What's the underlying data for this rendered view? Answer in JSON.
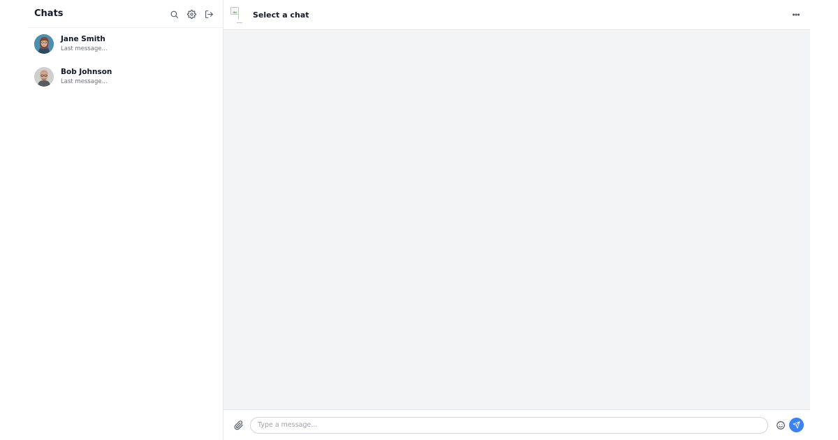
{
  "sidebar": {
    "title": "Chats",
    "actions": [
      {
        "name": "search-icon"
      },
      {
        "name": "gear-icon"
      },
      {
        "name": "logout-icon"
      }
    ],
    "chats": [
      {
        "name": "Jane Smith",
        "preview": "Last message...",
        "avatar": "woman-avatar"
      },
      {
        "name": "Bob Johnson",
        "preview": "Last message...",
        "avatar": "man-avatar"
      }
    ]
  },
  "main": {
    "header": {
      "title": "Select a chat",
      "menu_icon": "more-horizontal-icon"
    },
    "composer": {
      "placeholder": "Type a message...",
      "attach_icon": "paperclip-icon",
      "emoji_icon": "smile-icon",
      "send_icon": "send-icon"
    }
  },
  "colors": {
    "accent": "#3b82f6",
    "panel_bg": "#f3f4f6",
    "border": "#e5e7eb",
    "muted_text": "#6b7280"
  }
}
